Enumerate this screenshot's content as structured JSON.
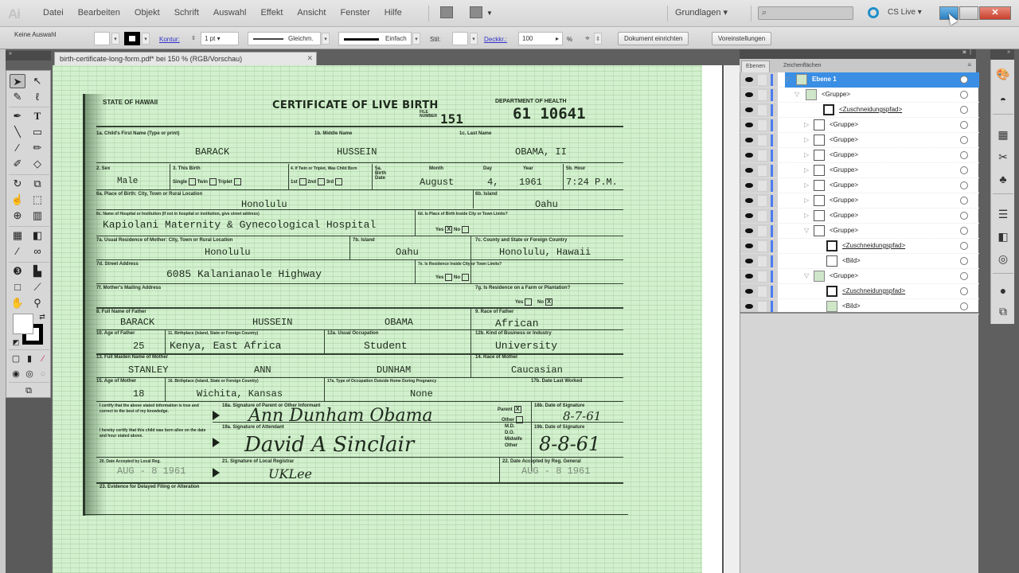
{
  "app": {
    "logo": "Ai",
    "menu": [
      "Datei",
      "Bearbeiten",
      "Objekt",
      "Schrift",
      "Auswahl",
      "Effekt",
      "Ansicht",
      "Fenster",
      "Hilfe"
    ],
    "workspace": "Grundlagen ▾",
    "search_placeholder": "",
    "search_icon": "⌕",
    "cs_live": "CS Live ▾",
    "window_close": "✕"
  },
  "control_bar": {
    "selection": "Keine Auswahl",
    "kontur_label": "Kontur:",
    "stroke_weight": "1 pt",
    "profile_label": "Gleichm.",
    "brush_label": "Einfach",
    "style_label": "Stil:",
    "opacity_label": "Deckkr.:",
    "opacity_value": "100",
    "percent": "%",
    "btn_document_setup": "Dokument einrichten",
    "btn_preferences": "Voreinstellungen"
  },
  "document": {
    "tab_title": "birth-certificate-long-form.pdf* bei 150 % (RGB/Vorschau)",
    "tab_close": "✕"
  },
  "certificate": {
    "state": "STATE OF HAWAII",
    "title": "CERTIFICATE OF LIVE BIRTH",
    "file_number_label": "FILE NUMBER",
    "file_number": "151",
    "dept": "DEPARTMENT OF HEALTH",
    "cert_number": "61 10641",
    "labels": {
      "child_first": "1a. Child's First Name (Type or print)",
      "child_middle": "1b. Middle Name",
      "child_last": "1c. Last Name",
      "sex": "2. Sex",
      "this_birth": "3. This Birth",
      "twin_q": "4. If Twin or Triplet, Was Child Born",
      "birth_date": "5a. Birth Date",
      "month": "Month",
      "day": "Day",
      "year": "Year",
      "hour": "5b. Hour",
      "place_city": "6a. Place of Birth: City, Town or Rural Location",
      "island": "6b. Island",
      "hospital": "6c. Name of Hospital or Institution (If not in hospital or institution, give street address)",
      "inside_city": "6d. Is Place of Birth Inside City or Town Limits?",
      "mother_residence": "7a. Usual Residence of Mother: City, Town or Rural Location",
      "res_island": "7b. Island",
      "county_state": "7c. County and State or Foreign Country",
      "street": "7d. Street Address",
      "res_inside_city": "7e. Is Residence Inside City or Town Limits?",
      "mailing": "7f. Mother's Mailing Address",
      "farm": "7g. Is Residence on a Farm or Plantation?",
      "father_name": "8. Full Name of Father",
      "father_race": "9. Race of Father",
      "father_age": "10. Age of Father",
      "father_birthplace": "11. Birthplace (Island, State or Foreign Country)",
      "father_occupation": "12a. Usual Occupation",
      "father_industry": "12b. Kind of Business or Industry",
      "mother_maiden": "13. Full Maiden Name of Mother",
      "mother_race": "14. Race of Mother",
      "mother_age": "15. Age of Mother",
      "mother_birthplace": "16. Birthplace (Island, State or Foreign Country)",
      "mother_occupation": "17a. Type of Occupation Outside Home During Pregnancy",
      "last_worked": "17b. Date Last Worked",
      "certify_parent": "I certify that the above stated information is true and correct to the best of my knowledge.",
      "parent_sig": "18a. Signature of Parent or Other Informant",
      "parent_date": "18b. Date of Signature",
      "certify_attendant": "I hereby certify that this child was born alive on the date and hour stated above.",
      "attendant_sig": "19a. Signature of Attendant",
      "attendant_date": "19b. Date of Signature",
      "accepted_local": "20. Date Accepted by Local Reg.",
      "local_registrar": "21. Signature of Local Registrar",
      "accepted_general": "22. Date Accepted by Reg. General",
      "evidence": "23. Evidence for Delayed Filing or Alteration",
      "yes": "Yes",
      "no": "No",
      "single": "Single",
      "twin": "Twin",
      "triplet": "Triplet",
      "first": "1st",
      "second": "2nd",
      "third": "3rd",
      "parent": "Parent",
      "other": "Other",
      "md": "M.D.",
      "do": "D.O.",
      "midwife": "Midwife",
      "other2": "Other"
    },
    "values": {
      "child_first": "BARACK",
      "child_middle": "HUSSEIN",
      "child_last": "OBAMA, II",
      "sex": "Male",
      "month": "August",
      "day": "4,",
      "year": "1961",
      "hour": "7:24 P.M.",
      "place_city": "Honolulu",
      "island": "Oahu",
      "hospital": "Kapiolani Maternity & Gynecological Hospital",
      "mother_city": "Honolulu",
      "res_island": "Oahu",
      "county_state": "Honolulu, Hawaii",
      "street": "6085 Kalanianaole Highway",
      "father_first": "BARACK",
      "father_middle": "HUSSEIN",
      "father_last": "OBAMA",
      "father_race": "African",
      "father_age": "25",
      "father_birthplace": "Kenya, East Africa",
      "father_occupation": "Student",
      "father_industry": "University",
      "mother_first": "STANLEY",
      "mother_middle": "ANN",
      "mother_last": "DUNHAM",
      "mother_race": "Caucasian",
      "mother_age": "18",
      "mother_birthplace": "Wichita, Kansas",
      "mother_occupation": "None",
      "parent_sig": "Ann Dunham Obama",
      "parent_date": "8-7-61",
      "attendant_sig": "David A Sinclair",
      "attendant_date": "8-8-61",
      "accepted_local": "AUG - 8 1961",
      "local_registrar": "UKLee",
      "accepted_general": "AUG - 8 1961",
      "check": "X"
    }
  },
  "layers_panel": {
    "tabs": [
      "Ebenen",
      "Zeichenflächen"
    ],
    "menu_icon": "≡",
    "rows": [
      {
        "name": "Ebene 1",
        "selected": true
      },
      {
        "name": "<Gruppe>"
      },
      {
        "name": "<Zuschneidungspfad>"
      },
      {
        "name": "<Gruppe>"
      },
      {
        "name": "<Gruppe>"
      },
      {
        "name": "<Gruppe>"
      },
      {
        "name": "<Gruppe>"
      },
      {
        "name": "<Gruppe>"
      },
      {
        "name": "<Gruppe>"
      },
      {
        "name": "<Gruppe>"
      },
      {
        "name": "<Gruppe>"
      },
      {
        "name": "<Zuschneidungspfad>"
      },
      {
        "name": "<Bild>"
      },
      {
        "name": "<Gruppe>"
      },
      {
        "name": "<Zuschneidungspfad>"
      },
      {
        "name": "<Bild>"
      }
    ],
    "collapse_icon": "»",
    "close_icon": "✕"
  },
  "colors": {
    "accent_blue": "#3a8fe4",
    "canvas_green": "#d2f0cd",
    "layer_color": "#4a7cf0",
    "cs_live_ring": "#1f8fc9",
    "close_red": "#c9402d"
  }
}
